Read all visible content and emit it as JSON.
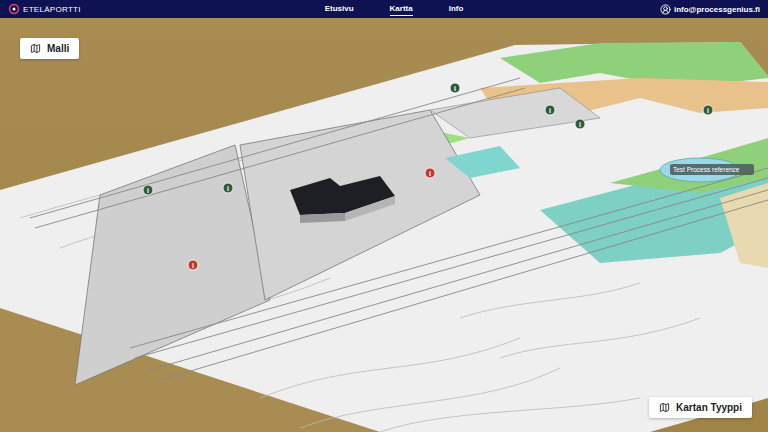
{
  "nav": {
    "logo": "ETELÄPORTTI",
    "links": [
      {
        "label": "Etusivu",
        "selected": false
      },
      {
        "label": "Kartta",
        "selected": true
      },
      {
        "label": "Info",
        "selected": false
      }
    ],
    "user": "info@processgenius.fi"
  },
  "map": {
    "model_button": "Malli",
    "type_button": "Kartan Tyyppi",
    "label": "Test Process reference",
    "markers": [
      {
        "symbol": "i",
        "color": "#2f5d3c"
      },
      {
        "symbol": "i",
        "color": "#2f5d3c"
      },
      {
        "symbol": "i",
        "color": "#2f5d3c"
      },
      {
        "symbol": "i",
        "color": "#2f5d3c"
      },
      {
        "symbol": "i",
        "color": "#2f5d3c"
      },
      {
        "symbol": "i",
        "color": "#2f5d3c"
      },
      {
        "symbol": "i",
        "color": "#c0392b"
      },
      {
        "symbol": "i",
        "color": "#c0392b"
      }
    ]
  }
}
